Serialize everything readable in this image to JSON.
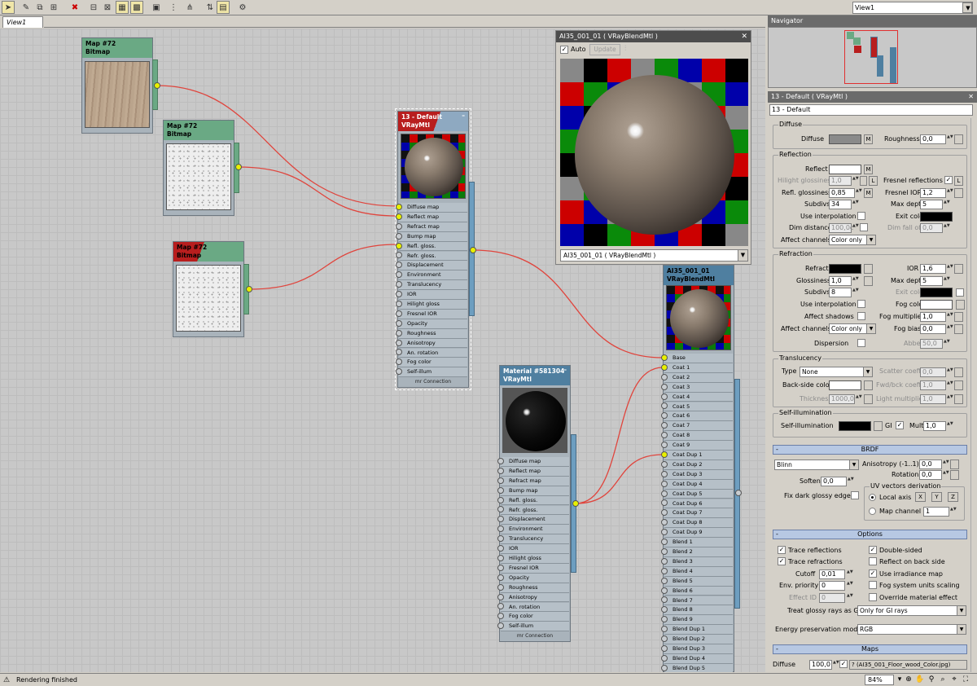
{
  "toolbar": {
    "icons": [
      "select-icon",
      "eyedropper-icon",
      "pick-material-icon",
      "assign-material-icon",
      "delete-icon",
      "layout-icon",
      "layout-children-icon",
      "hide-unused-icon",
      "checker-icon",
      "background-icon",
      "options-icon",
      "nodes-icon",
      "show-map-icon",
      "settings-icon"
    ],
    "view_select": "View1"
  },
  "tabs": {
    "view": "View1"
  },
  "nodes": {
    "map1": {
      "title": "Map #72",
      "type": "Bitmap"
    },
    "map2": {
      "title": "Map #72",
      "type": "Bitmap"
    },
    "map3": {
      "title": "Map #72",
      "type": "Bitmap"
    },
    "mat13": {
      "title": "13 - Default",
      "type": "VRayMtl"
    },
    "mat581": {
      "title": "Material #581304",
      "type": "VRayMtl"
    },
    "blend": {
      "title": "AI35_001_01",
      "type": "VRayBlendMtl"
    },
    "vray_slots": [
      "Diffuse map",
      "Reflect map",
      "Refract map",
      "Bump map",
      "Refl. gloss.",
      "Refr. gloss.",
      "Displacement",
      "Environment",
      "Translucency",
      "IOR",
      "Hilight gloss",
      "Fresnel IOR",
      "Opacity",
      "Roughness",
      "Anisotropy",
      "An. rotation",
      "Fog color",
      "Self-illum"
    ],
    "connection_label": "mr Connection",
    "blend_slots": [
      "Base",
      "Coat 1",
      "Coat 2",
      "Coat 3",
      "Coat 4",
      "Coat 5",
      "Coat 6",
      "Coat 7",
      "Coat 8",
      "Coat 9",
      "Coat Dup 1",
      "Coat Dup 2",
      "Coat Dup 3",
      "Coat Dup 4",
      "Coat Dup 5",
      "Coat Dup 6",
      "Coat Dup 7",
      "Coat Dup 8",
      "Coat Dup 9",
      "Blend 1",
      "Blend 2",
      "Blend 3",
      "Blend 4",
      "Blend 5",
      "Blend 6",
      "Blend 7",
      "Blend 8",
      "Blend 9",
      "Blend Dup 1",
      "Blend Dup 2",
      "Blend Dup 3",
      "Blend Dup 4",
      "Blend Dup 5"
    ]
  },
  "preview": {
    "title": "AI35_001_01  ( VRayBlendMtl )",
    "auto_label": "Auto",
    "auto_checked": true,
    "update_label": "Update",
    "select_value": "AI35_001_01  ( VRayBlendMtl )"
  },
  "navigator": {
    "title": "Navigator"
  },
  "material_panel": {
    "title": "13 - Default  ( VRayMtl )",
    "name": "13 - Default",
    "diffuse": {
      "group": "Diffuse",
      "diffuse_label": "Diffuse",
      "m": "M",
      "roughness_label": "Roughness",
      "roughness": "0,0"
    },
    "reflection": {
      "group": "Reflection",
      "reflect_label": "Reflect",
      "m": "M",
      "hilight_label": "Hilight glossiness",
      "hilight": "1,0",
      "l": "L",
      "fresnel_label": "Fresnel reflections",
      "fresnel_checked": true,
      "refl_gloss_label": "Refl. glossiness",
      "refl_gloss": "0,85",
      "fresnel_ior_label": "Fresnel IOR",
      "fresnel_ior": "1,2",
      "subdivs_label": "Subdivs",
      "subdivs": "34",
      "max_depth_label": "Max depth",
      "max_depth": "5",
      "use_interp_label": "Use interpolation",
      "exit_color_label": "Exit color",
      "dim_dist_label": "Dim distance",
      "dim_dist": "100,0c",
      "dim_falloff_label": "Dim fall off",
      "dim_falloff": "0,0",
      "affect_label": "Affect channels",
      "affect": "Color only"
    },
    "refraction": {
      "group": "Refraction",
      "refract_label": "Refract",
      "ior_label": "IOR",
      "ior": "1,6",
      "gloss_label": "Glossiness",
      "gloss": "1,0",
      "max_depth_label": "Max depth",
      "max_depth": "5",
      "subdivs_label": "Subdivs",
      "subdivs": "8",
      "exit_color_label": "Exit color",
      "use_interp_label": "Use interpolation",
      "fog_color_label": "Fog color",
      "affect_shadows_label": "Affect shadows",
      "fog_mult_label": "Fog multiplier",
      "fog_mult": "1,0",
      "affect_label": "Affect channels",
      "affect": "Color only",
      "fog_bias_label": "Fog bias",
      "fog_bias": "0,0",
      "dispersion_label": "Dispersion",
      "abbe_label": "Abbe",
      "abbe": "50,0"
    },
    "translucency": {
      "group": "Translucency",
      "type_label": "Type",
      "type": "None",
      "scatter_label": "Scatter coeff",
      "scatter": "0,0",
      "backside_label": "Back-side color",
      "fwd_label": "Fwd/bck coeff",
      "fwd": "1,0",
      "thickness_label": "Thickness",
      "thickness": "1000,0",
      "light_mult_label": "Light multiplier",
      "light_mult": "1,0"
    },
    "selfillum": {
      "group": "Self-illumination",
      "label": "Self-illumination",
      "gi_label": "GI",
      "gi_checked": true,
      "mult_label": "Mult",
      "mult": "1,0"
    },
    "brdf": {
      "title": "BRDF",
      "collapse": "-",
      "type": "Blinn",
      "aniso_label": "Anisotropy (-1..1)",
      "aniso": "0,0",
      "rotation_label": "Rotation",
      "rotation": "0,0",
      "soften_label": "Soften",
      "soften": "0,0",
      "uv_group": "UV vectors derivation",
      "local_axis_label": "Local axis",
      "x": "X",
      "y": "Y",
      "z": "Z",
      "fix_label": "Fix dark glossy edges",
      "map_channel_label": "Map channel",
      "map_channel": "1"
    },
    "options": {
      "title": "Options",
      "collapse": "-",
      "trace_refl_label": "Trace reflections",
      "trace_refr_label": "Trace refractions",
      "double_sided_label": "Double-sided",
      "reflect_back_label": "Reflect on back side",
      "cutoff_label": "Cutoff",
      "cutoff": "0,01",
      "use_irr_label": "Use irradiance map",
      "env_prio_label": "Env. priority",
      "env_prio": "0",
      "fog_units_label": "Fog system units scaling",
      "effect_id_label": "Effect ID",
      "effect_id": "0",
      "override_label": "Override material effect",
      "treat_glossy_label": "Treat glossy rays as GI",
      "treat_glossy": "Only for GI rays",
      "energy_label": "Energy preservation mode:",
      "energy": "RGB"
    },
    "maps": {
      "title": "Maps",
      "collapse": "-",
      "diffuse_label": "Diffuse",
      "diffuse_amount": "100,0",
      "diffuse_map": "? (AI35_001_Floor_wood_Color.jpg)"
    }
  },
  "status": {
    "text": "Rendering finished",
    "zoom": "84%"
  },
  "colors": {
    "wire": "#e0443c",
    "socket_active": "#e8f000",
    "bitmap_header": "#6aa984",
    "vray_header": "#4f7fa0"
  }
}
